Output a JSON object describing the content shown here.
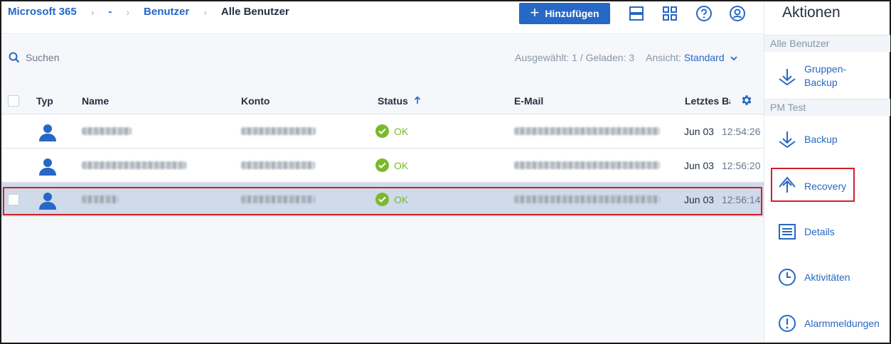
{
  "breadcrumb": {
    "items": [
      "Microsoft 365",
      "-",
      "Benutzer"
    ],
    "current": "Alle Benutzer"
  },
  "toolbar": {
    "add_label": "Hinzufügen",
    "icons": [
      "list-view-icon",
      "grid-view-icon",
      "help-icon",
      "account-icon"
    ]
  },
  "search": {
    "label": "Suchen"
  },
  "summary": {
    "selection": "Ausgewählt: 1 / Geladen: 3",
    "view_label": "Ansicht:",
    "view_value": "Standard"
  },
  "table": {
    "columns": [
      "Typ",
      "Name",
      "Konto",
      "Status",
      "E-Mail",
      "Letztes Ba"
    ],
    "rows": [
      {
        "status": "OK",
        "date": "Jun 03",
        "time": "12:54:26",
        "selected": false
      },
      {
        "status": "OK",
        "date": "Jun 03",
        "time": "12:56:20",
        "selected": false
      },
      {
        "status": "OK",
        "date": "Jun 03",
        "time": "12:56:14",
        "selected": true
      }
    ]
  },
  "panel": {
    "title": "Aktionen",
    "section_all": "Alle Benutzer",
    "group_backup_line1": "Gruppen-",
    "group_backup_line2": "Backup",
    "section_user": "PM Test",
    "backup": "Backup",
    "recovery": "Recovery",
    "details": "Details",
    "activities": "Aktivitäten",
    "alarms": "Alarmmeldungen"
  },
  "colors": {
    "accent": "#2668c5",
    "ok": "#7cb82f",
    "selected_row": "#cfdaea",
    "highlight": "#d0202a"
  }
}
